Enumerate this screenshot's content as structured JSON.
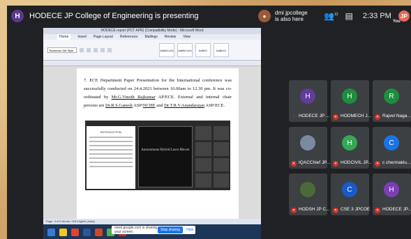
{
  "meet": {
    "presenter_avatar_letter": "H",
    "presentation_title": "HODECE JP College of Engineering is presenting",
    "notification": {
      "line1": "dmi jpcollege",
      "line2": "is also here"
    },
    "participants_count_badge": "12",
    "time": "2:33 PM",
    "you_avatar_letter": "JP",
    "you_label": "You"
  },
  "word": {
    "window_title": "HODECE report (PCT APR) (Compatibility Mode) - Microsoft Word",
    "menu": [
      "Home",
      "Insert",
      "Page Layout",
      "References",
      "Mailings",
      "Review",
      "View"
    ],
    "font_name": "Bookman Old Style",
    "styles": [
      "AaBbCcDc",
      "AaBbCcDc",
      "AaBbC",
      "AaBbCc"
    ],
    "paragraph": {
      "part1": "7.   ECE Department Paper Presentation for the International conference was successfully conducted on 24.4.2021 between 10.00am to 12.30 pm.  It was co-ordinated by ",
      "coord": "Mr.G.Vinoth Rajkumar",
      "part2": " AP/ECE.  External and internal chair persons are ",
      "ext": "Dr.R.S.Ganesh",
      "part3": " ASP/",
      "nchit": "NCHE",
      "part4": "  and ",
      "int": "Dr.T.R.V.Anandarajan",
      "part5": " ASP/ECE."
    },
    "embedded_doc_heading": "INTRODUCTION",
    "embedded_slide_text": "Autonomous Hybrid Lawn Mower",
    "status_bar": "Page: 3 of 5    Words: 326    English (India)"
  },
  "share_banner": {
    "message": "meet.google.com is sharing your screen.",
    "stop_label": "Stop sharing",
    "hide_label": "Hide"
  },
  "participants": [
    {
      "letter": "H",
      "color": "#5f3d99",
      "name": "HODECE JP ...",
      "muted": false
    },
    {
      "letter": "H",
      "color": "#1e8e3e",
      "name": "HODMECH J...",
      "muted": true
    },
    {
      "letter": "R",
      "color": "#1e8e3e",
      "name": "Rajvel Naga...",
      "muted": true
    },
    {
      "letter": "",
      "color": "#7a8aa0",
      "name": "IQACChief JP...",
      "muted": true
    },
    {
      "letter": "H",
      "color": "#34a853",
      "name": "HODCIVIL JP...",
      "muted": true
    },
    {
      "letter": "C",
      "color": "#1a73e8",
      "name": "c chermaklu...",
      "muted": true
    },
    {
      "letter": "",
      "color": "#4a6a3a",
      "name": "HODSH JP C...",
      "muted": true
    },
    {
      "letter": "C",
      "color": "#1a5ac8",
      "name": "CSE 3 JPCOE",
      "muted": true
    },
    {
      "letter": "H",
      "color": "#7b3fb5",
      "name": "HODECE JP...",
      "muted": true
    }
  ]
}
